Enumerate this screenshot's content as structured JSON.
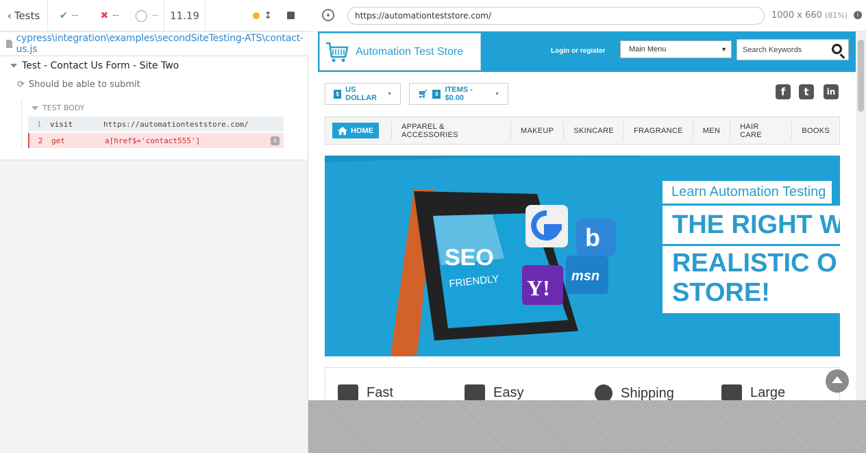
{
  "runner": {
    "tests_label": "Tests",
    "passed": "--",
    "failed": "--",
    "pending": "--",
    "duration": "11.19"
  },
  "spec": {
    "path": "cypress\\integration\\examples\\secondSiteTesting-ATS\\contact-us.js"
  },
  "reporter": {
    "suite_title": "Test - Contact Us Form - Site Two",
    "test_title": "Should be able to submit",
    "body_label": "TEST BODY",
    "commands": [
      {
        "num": "1",
        "name": "visit",
        "message": "https://automationteststore.com/"
      },
      {
        "num": "2",
        "name": "get",
        "message": "a[href$='contact555']",
        "badge": "0"
      }
    ]
  },
  "browser": {
    "url": "https://automationteststore.com/",
    "viewport": "1000 x 660",
    "scale": "(81%)",
    "info": "i"
  },
  "site": {
    "logo_text": "Automation Test Store",
    "login_label": "Login or register",
    "main_menu": "Main Menu",
    "search_placeholder": "Search Keywords",
    "currency_label": "US DOLLAR",
    "currency_symbol": "$",
    "cart_count": "0",
    "cart_label": "ITEMS - $0.00",
    "social": {
      "facebook": "f",
      "twitter": "t",
      "linkedin": "in"
    },
    "nav": {
      "home": "HOME",
      "items": [
        "APPAREL & ACCESSORIES",
        "MAKEUP",
        "SKINCARE",
        "FRAGRANCE",
        "MEN",
        "HAIR CARE",
        "BOOKS"
      ]
    },
    "hero": {
      "caption1": "Learn Automation Testing",
      "caption2": "THE RIGHT W",
      "caption3": "REALISTIC O\nSTORE!",
      "seo_text": "SEO",
      "friendly_text": "FRIENDLY",
      "yahoo_text": "Y!",
      "msn_text": "msn",
      "bing_text": "b"
    },
    "features": [
      "Fast",
      "Easy",
      "Shipping",
      "Large"
    ]
  },
  "colors": {
    "accent": "#1fa1d5",
    "pass": "#3aa56a",
    "fail": "#e0484f",
    "link": "#3286cc"
  }
}
